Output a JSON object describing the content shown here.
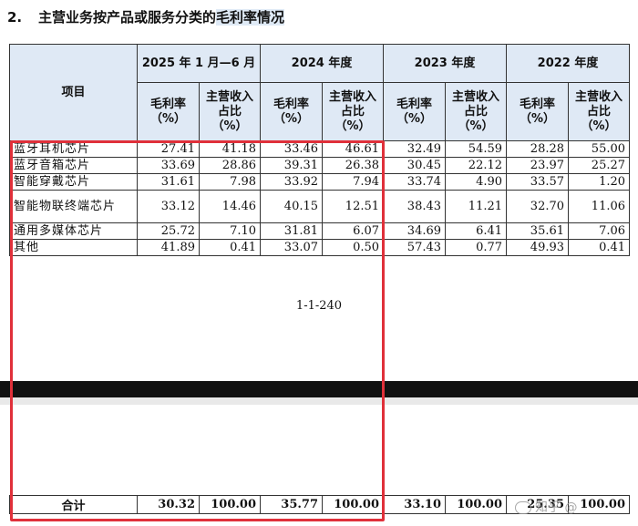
{
  "heading": {
    "number": "2.",
    "text": "主营业务按产品或服务分类的",
    "highlight": "毛利率情况"
  },
  "table": {
    "item_header": "项目",
    "periods": [
      "2025 年 1 月—6 月",
      "2024 年度",
      "2023 年度",
      "2022 年度"
    ],
    "sub_headers": [
      "毛利率（%）",
      "主营收入占比（%）"
    ],
    "rows": [
      {
        "label": "蓝牙耳机芯片",
        "values": [
          "27.41",
          "41.18",
          "33.46",
          "46.61",
          "32.49",
          "54.59",
          "28.28",
          "55.00"
        ]
      },
      {
        "label": "蓝牙音箱芯片",
        "values": [
          "33.69",
          "28.86",
          "39.31",
          "26.38",
          "30.45",
          "22.12",
          "23.97",
          "25.27"
        ]
      },
      {
        "label": "智能穿戴芯片",
        "values": [
          "31.61",
          "7.98",
          "33.92",
          "7.94",
          "33.74",
          "4.90",
          "33.57",
          "1.20"
        ]
      },
      {
        "label": "智能物联终端芯片",
        "values": [
          "33.12",
          "14.46",
          "40.15",
          "12.51",
          "38.43",
          "11.21",
          "32.70",
          "11.06"
        ]
      },
      {
        "label": "通用多媒体芯片",
        "values": [
          "25.72",
          "7.10",
          "31.81",
          "6.07",
          "34.69",
          "6.41",
          "35.61",
          "7.06"
        ]
      },
      {
        "label": "其他",
        "values": [
          "41.89",
          "0.41",
          "33.07",
          "0.50",
          "57.43",
          "0.77",
          "49.93",
          "0.41"
        ]
      }
    ],
    "total": {
      "label": "合计",
      "values": [
        "30.32",
        "100.00",
        "35.77",
        "100.00",
        "33.10",
        "100.00",
        "25.35",
        "100.00"
      ]
    }
  },
  "page_number": "1-1-240",
  "watermark": "知乎 @"
}
